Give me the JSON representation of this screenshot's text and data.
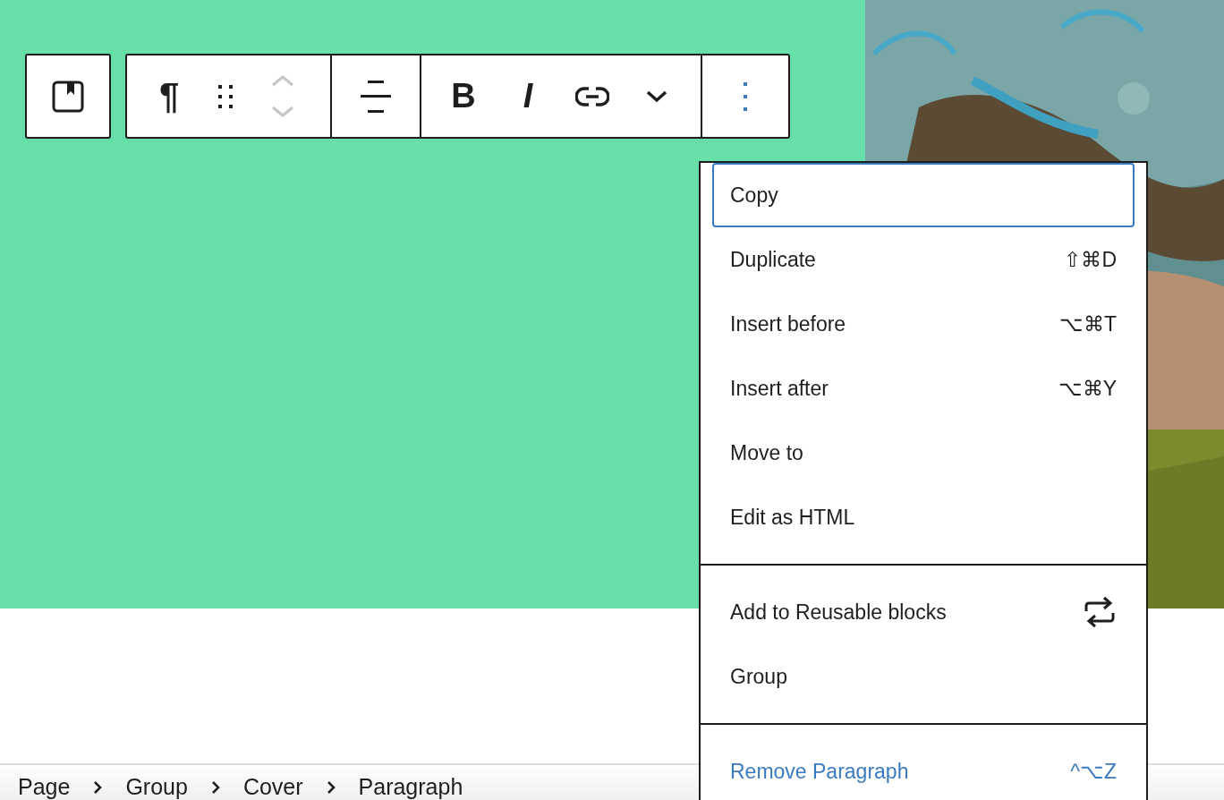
{
  "toolbar": {
    "paragraph_glyph": "¶",
    "bold": "B",
    "italic": "I",
    "mover_disabled": true,
    "options_expanded": true
  },
  "menu": {
    "groups": [
      {
        "items": [
          {
            "label": "Copy",
            "focused": true,
            "kind": "plain"
          },
          {
            "label": "Duplicate",
            "shortcut": "⇧⌘D",
            "focused": false,
            "kind": "plain"
          },
          {
            "label": "Insert before",
            "shortcut": "⌥⌘T",
            "focused": false,
            "kind": "plain"
          },
          {
            "label": "Insert after",
            "shortcut": "⌥⌘Y",
            "focused": false,
            "kind": "plain"
          },
          {
            "label": "Move to",
            "focused": false,
            "kind": "plain"
          },
          {
            "label": "Edit as HTML",
            "focused": false,
            "kind": "plain"
          }
        ]
      },
      {
        "items": [
          {
            "label": "Add to Reusable blocks",
            "focused": false,
            "kind": "reusable"
          },
          {
            "label": "Group",
            "focused": false,
            "kind": "plain"
          }
        ]
      },
      {
        "items": [
          {
            "label": "Remove Paragraph",
            "shortcut": "^⌥Z",
            "focused": false,
            "kind": "remove"
          }
        ]
      }
    ]
  },
  "breadcrumb": [
    "Page",
    "Group",
    "Cover",
    "Paragraph"
  ]
}
